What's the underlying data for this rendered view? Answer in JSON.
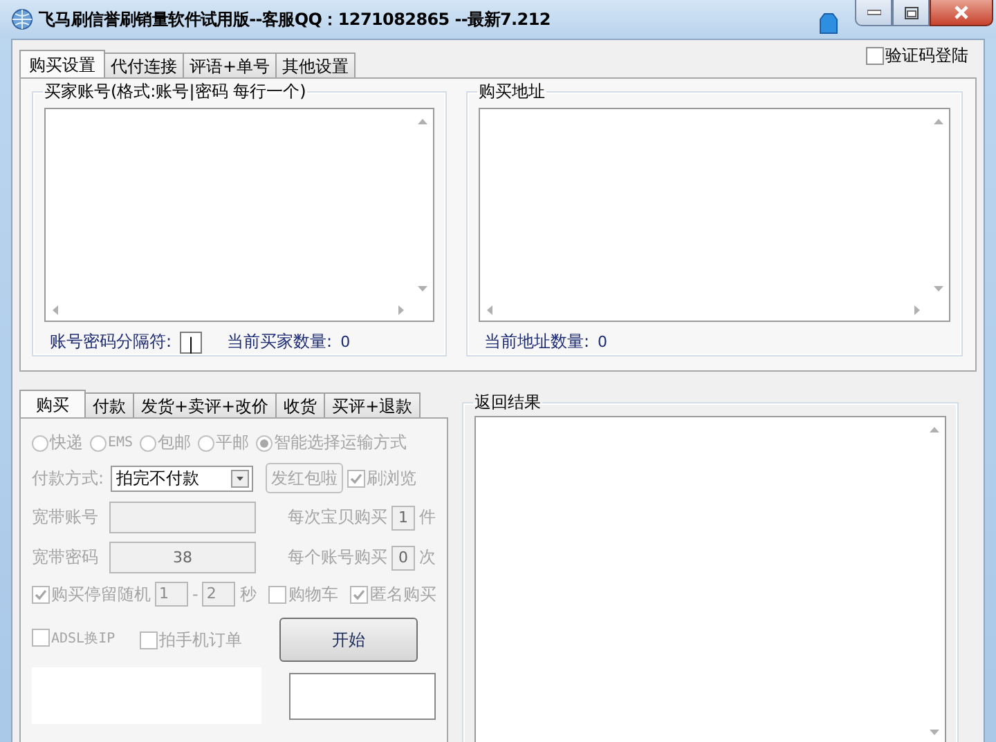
{
  "window": {
    "title": "飞马刷信誉刷销量软件试用版--客服QQ：1271082865 --最新7.212"
  },
  "top_tabs": [
    {
      "label": "购买设置",
      "selected": true
    },
    {
      "label": "代付连接",
      "selected": false
    },
    {
      "label": "评语+单号",
      "selected": false
    },
    {
      "label": "其他设置",
      "selected": false
    }
  ],
  "captcha_login": {
    "label": "验证码登陆",
    "checked": false
  },
  "buyer_accounts": {
    "title": "买家账号(格式:账号|密码 每行一个)",
    "separator_label": "账号密码分隔符:",
    "separator_value": "|",
    "count_label": "当前买家数量:",
    "count_value": "0"
  },
  "addresses": {
    "title": "购买地址",
    "count_label": "当前地址数量:",
    "count_value": "0"
  },
  "lower_tabs": [
    {
      "label": "购买",
      "selected": true
    },
    {
      "label": "付款",
      "selected": false
    },
    {
      "label": "发货+卖评+改价",
      "selected": false
    },
    {
      "label": "收货",
      "selected": false
    },
    {
      "label": "买评+退款",
      "selected": false
    }
  ],
  "shipping_options": [
    {
      "label": "快递",
      "selected": false
    },
    {
      "label": "EMS",
      "selected": false
    },
    {
      "label": "包邮",
      "selected": false
    },
    {
      "label": "平邮",
      "selected": false
    },
    {
      "label": "智能选择运输方式",
      "selected": true
    }
  ],
  "payment": {
    "label": "付款方式:",
    "value": "拍完不付款"
  },
  "red_packet_button": {
    "label": "发红包啦"
  },
  "brush_views": {
    "label": "刷浏览",
    "checked": true
  },
  "broadband_account": {
    "label": "宽带账号"
  },
  "broadband_password": {
    "label": "宽带密码",
    "value": "38"
  },
  "per_item": {
    "label": "每次宝贝购买",
    "value": "1",
    "unit": "件"
  },
  "per_account": {
    "label": "每个账号购买",
    "value": "0",
    "unit": "次"
  },
  "stay_random": {
    "label": "购买停留随机",
    "checked": true,
    "min": "1",
    "separator": "-",
    "max": "2",
    "unit": "秒"
  },
  "cart": {
    "label": "购物车",
    "checked": false
  },
  "anonymous": {
    "label": "匿名购买",
    "checked": true
  },
  "adsl": {
    "label": "ADSL换IP",
    "checked": false
  },
  "phone_order": {
    "label": "拍手机订单",
    "checked": false
  },
  "start_button": {
    "label": "开始"
  },
  "result": {
    "title": "返回结果"
  }
}
